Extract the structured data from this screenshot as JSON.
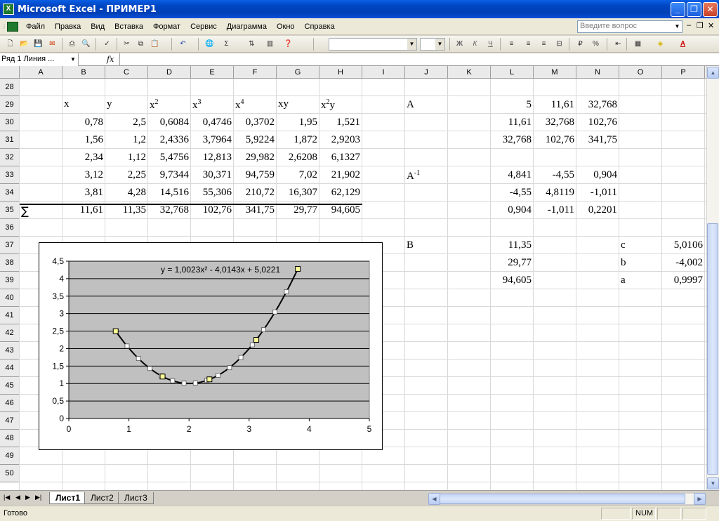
{
  "window": {
    "title": "Microsoft Excel - ПРИМЕР1",
    "minimize": "_",
    "restore": "❐",
    "close": "✕"
  },
  "menu": {
    "items": [
      "Файл",
      "Правка",
      "Вид",
      "Вставка",
      "Формат",
      "Сервис",
      "Диаграмма",
      "Окно",
      "Справка"
    ],
    "ask_placeholder": "Введите вопрос"
  },
  "formula_bar": {
    "name_box": "Ряд 1 Линия ...",
    "fx": "fx"
  },
  "columns": [
    "A",
    "B",
    "C",
    "D",
    "E",
    "F",
    "G",
    "H",
    "I",
    "J",
    "K",
    "L",
    "M",
    "N",
    "O",
    "P"
  ],
  "rows": [
    "28",
    "29",
    "30",
    "31",
    "32",
    "33",
    "34",
    "35",
    "36",
    "37",
    "38",
    "39",
    "40",
    "41",
    "42",
    "43",
    "44",
    "45",
    "46",
    "47",
    "48",
    "49",
    "50"
  ],
  "table": {
    "headers": [
      "x",
      "y",
      "x2",
      "x3",
      "x4",
      "xy",
      "x2y"
    ],
    "data": [
      [
        "0,78",
        "2,5",
        "0,6084",
        "0,4746",
        "0,3702",
        "1,95",
        "1,521"
      ],
      [
        "1,56",
        "1,2",
        "2,4336",
        "3,7964",
        "5,9224",
        "1,872",
        "2,9203"
      ],
      [
        "2,34",
        "1,12",
        "5,4756",
        "12,813",
        "29,982",
        "2,6208",
        "6,1327"
      ],
      [
        "3,12",
        "2,25",
        "9,7344",
        "30,371",
        "94,759",
        "7,02",
        "21,902"
      ],
      [
        "3,81",
        "4,28",
        "14,516",
        "55,306",
        "210,72",
        "16,307",
        "62,129"
      ]
    ],
    "sum_symbol": "∑",
    "sums": [
      "11,61",
      "11,35",
      "32,768",
      "102,76",
      "341,75",
      "29,77",
      "94,605"
    ]
  },
  "matrix_A": {
    "label": "A",
    "rows": [
      [
        "5",
        "11,61",
        "32,768"
      ],
      [
        "11,61",
        "32,768",
        "102,76"
      ],
      [
        "32,768",
        "102,76",
        "341,75"
      ]
    ]
  },
  "matrix_Ainv": {
    "label": "A",
    "sup": "-1",
    "rows": [
      [
        "4,841",
        "-4,55",
        "0,904"
      ],
      [
        "-4,55",
        "4,8119",
        "-1,011"
      ],
      [
        "0,904",
        "-1,011",
        "0,2201"
      ]
    ]
  },
  "vector_B": {
    "label": "B",
    "values": [
      "11,35",
      "29,77",
      "94,605"
    ]
  },
  "coefficients": [
    {
      "name": "c",
      "value": "5,0106"
    },
    {
      "name": "b",
      "value": "-4,002"
    },
    {
      "name": "a",
      "value": "0,9997"
    }
  ],
  "sheet_tabs": [
    "Лист1",
    "Лист2",
    "Лист3"
  ],
  "status": {
    "ready": "Готово",
    "num": "NUM"
  },
  "colors": {
    "plot_area": "#c0c0c0",
    "trend_line": "#000000",
    "marker": "#ffff99"
  },
  "chart_data": {
    "type": "scatter",
    "trendline_label": "y = 1,0023x² - 4,0143x + 5,0221",
    "xlim": [
      0,
      5
    ],
    "ylim": [
      0,
      4.5
    ],
    "x_ticks": [
      "0",
      "1",
      "2",
      "3",
      "4",
      "5"
    ],
    "y_ticks": [
      "0",
      "0,5",
      "1",
      "1,5",
      "2",
      "2,5",
      "3",
      "3,5",
      "4",
      "4,5"
    ],
    "points": [
      {
        "x": 0.78,
        "y": 2.5
      },
      {
        "x": 1.56,
        "y": 1.2
      },
      {
        "x": 2.34,
        "y": 1.12
      },
      {
        "x": 3.12,
        "y": 2.25
      },
      {
        "x": 3.81,
        "y": 4.28
      }
    ],
    "trend": {
      "a": 1.0023,
      "b": -4.0143,
      "c": 5.0221,
      "x_from": 0.78,
      "x_to": 3.81
    },
    "grid": true,
    "legend": "none"
  }
}
